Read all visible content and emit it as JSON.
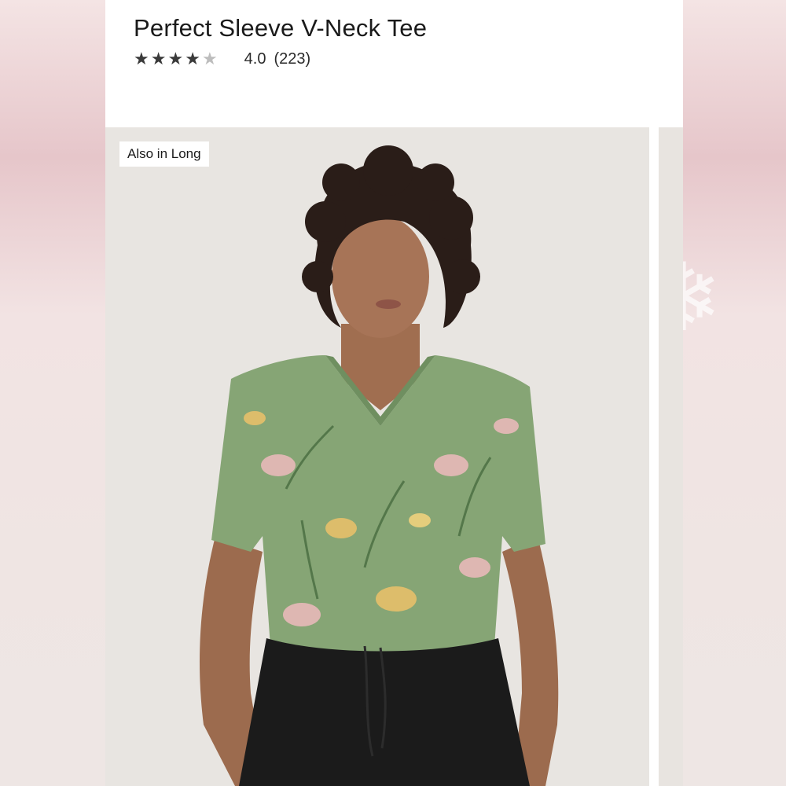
{
  "product": {
    "title": "Perfect Sleeve V-Neck Tee",
    "rating": {
      "value": 4.0,
      "display": "4.0",
      "count_display": "(223)",
      "stars_total": 5,
      "stars_filled": 4
    }
  },
  "gallery": {
    "badge": "Also in Long",
    "image_alt": "Model wearing green floral butterfly print v-neck tee with black pants"
  },
  "colors": {
    "tee_green": "#86a575",
    "pants_black": "#1b1b1b",
    "page_accent_pink": "#e6c6ca"
  },
  "icons": [
    "star-icon",
    "snowflake-icon"
  ]
}
